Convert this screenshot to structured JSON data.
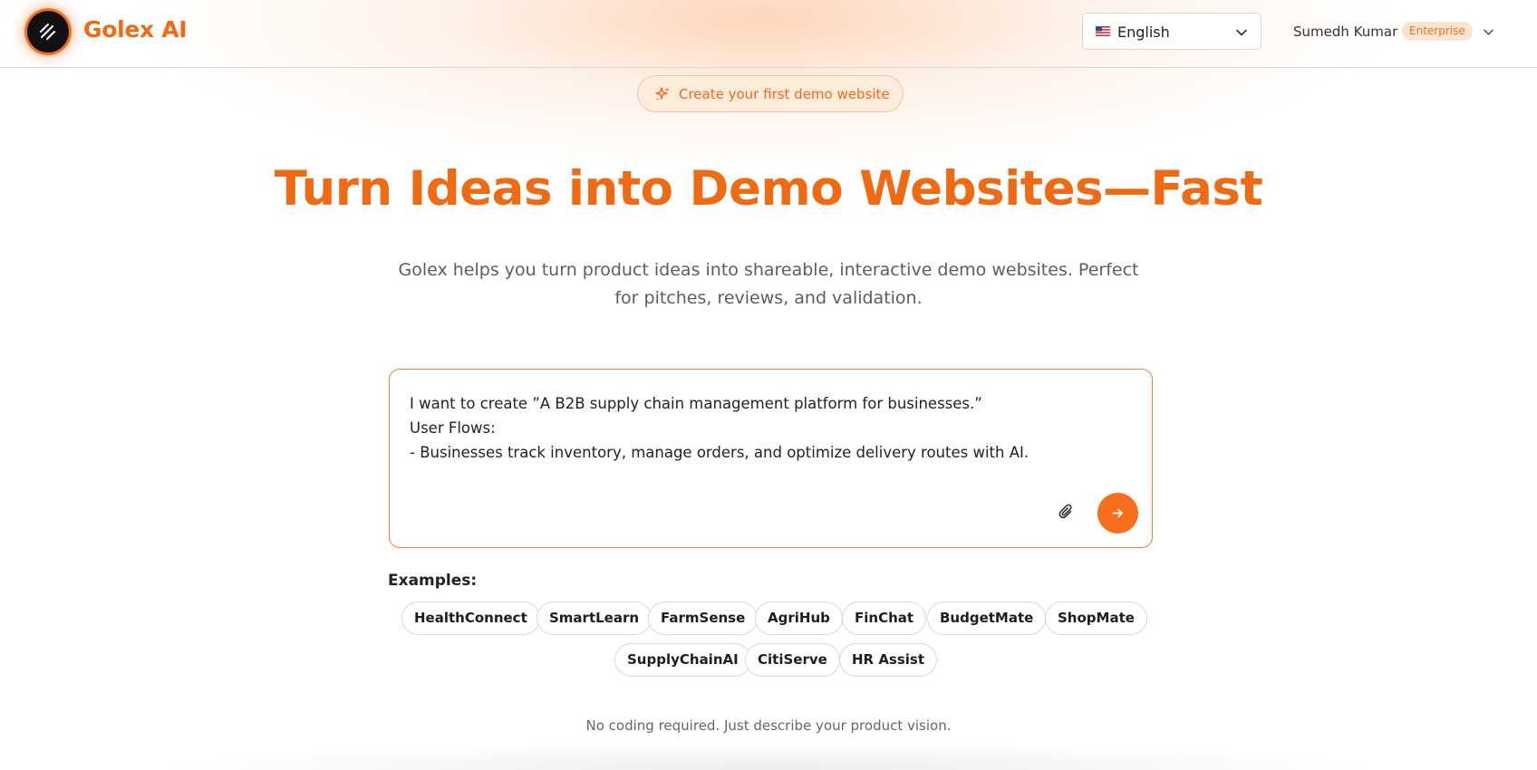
{
  "brand": {
    "name": "Golex AI",
    "logo_icon": "three-slash-logo-icon",
    "accent_color": "#ef6a14"
  },
  "header": {
    "language": {
      "label": "English",
      "flag_icon": "us-flag-icon",
      "chevron_icon": "chevron-down-icon"
    },
    "user": {
      "name": "Sumedh Kumar",
      "plan": "Enterprise",
      "chevron_icon": "chevron-down-icon"
    }
  },
  "promo": {
    "label": "Create your first demo website",
    "icon": "sparkles-icon"
  },
  "hero": {
    "title": "Turn Ideas into Demo Websites—Fast",
    "subtitle": "Golex helps you turn product ideas into shareable, interactive demo websites. Perfect for pitches, reviews, and validation."
  },
  "prompt": {
    "text": "I want to create ”A B2B supply chain management platform for businesses.”\nUser Flows:\n- Businesses track inventory, manage orders, and optimize delivery routes with AI.",
    "attach_icon": "paperclip-icon",
    "send_icon": "arrow-right-icon"
  },
  "examples": {
    "label": "Examples:",
    "items": [
      "HealthConnect",
      "SmartLearn",
      "FarmSense",
      "AgriHub",
      "FinChat",
      "BudgetMate",
      "ShopMate",
      "SupplyChainAI",
      "CitiServe",
      "HR Assist"
    ]
  },
  "footnote": "No coding required. Just describe your product vision."
}
